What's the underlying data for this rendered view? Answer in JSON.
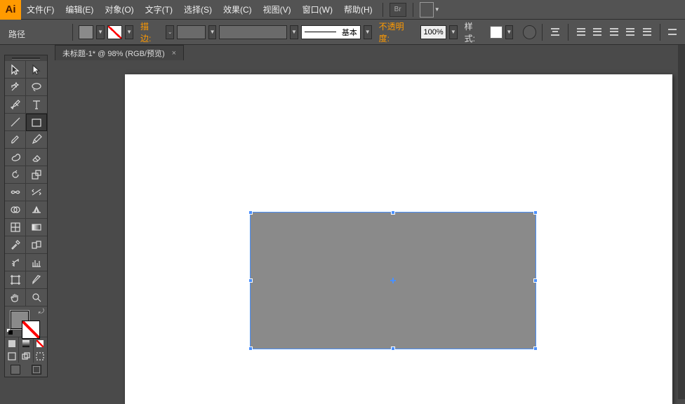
{
  "app": {
    "logo": "Ai"
  },
  "menu": {
    "file": "文件(F)",
    "edit": "编辑(E)",
    "object": "对象(O)",
    "type": "文字(T)",
    "select": "选择(S)",
    "effect": "效果(C)",
    "view": "视图(V)",
    "window": "窗口(W)",
    "help": "帮助(H)",
    "bridge": "Br"
  },
  "context_label": "路径",
  "options": {
    "stroke_label": "描边:",
    "brush_preset": "基本",
    "opacity_label": "不透明度:",
    "opacity_value": "100%",
    "style_label": "样式:"
  },
  "tab": {
    "title": "未标题-1* @ 98% (RGB/预览)",
    "close": "×"
  },
  "colors": {
    "fill": "#8a8a8a",
    "selection": "#4a90ff",
    "canvas": "#ffffff"
  },
  "tools": {
    "sel": "selection",
    "dsel": "direct-selection",
    "wand": "magic-wand",
    "lasso": "lasso",
    "pen": "pen",
    "type": "type",
    "line": "line",
    "rect": "rectangle",
    "brush": "paintbrush",
    "pencil": "pencil",
    "blob": "blob-brush",
    "eraser": "eraser",
    "rotate": "rotate",
    "reflect": "scale",
    "width": "width",
    "warp": "free-transform",
    "shb": "shape-builder",
    "lpaint": "perspective-grid",
    "mesh": "mesh",
    "grad": "gradient",
    "eyed": "eyedropper",
    "blend": "blend",
    "sym": "symbol-sprayer",
    "graph": "column-graph",
    "artb": "artboard",
    "slice": "slice",
    "hand": "hand",
    "zoom": "zoom"
  }
}
